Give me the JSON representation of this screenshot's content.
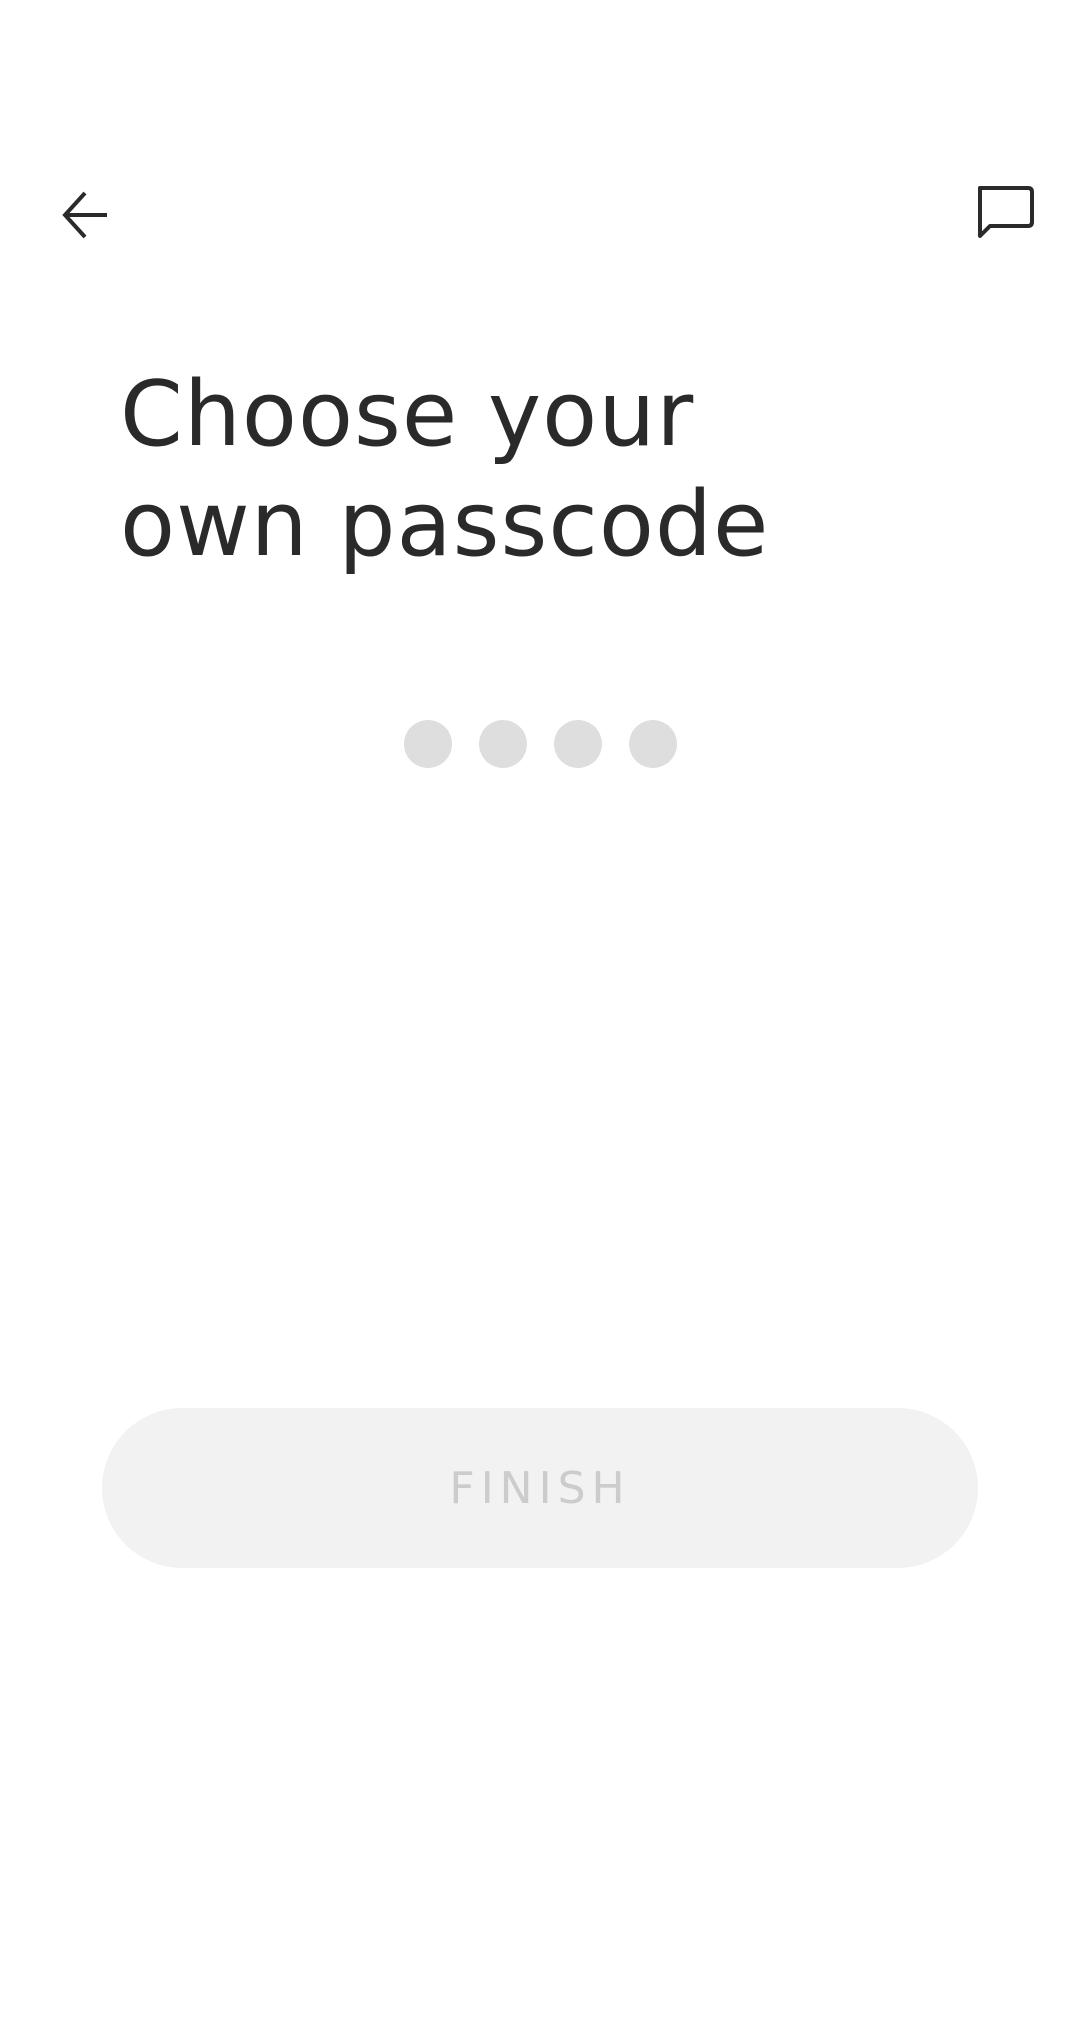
{
  "header": {
    "back_icon": "arrow-left-icon",
    "chat_icon": "chat-bubble-icon"
  },
  "title": {
    "line1": "Choose your",
    "line2": "own passcode"
  },
  "passcode": {
    "length": 4,
    "entered": 0,
    "dot_color": "#dedede"
  },
  "footer": {
    "finish_label": "FINISH",
    "finish_enabled": false,
    "finish_bg": "#f2f2f2",
    "finish_text_color": "#cccccc"
  },
  "colors": {
    "text": "#2a2a2a",
    "background": "#ffffff"
  }
}
